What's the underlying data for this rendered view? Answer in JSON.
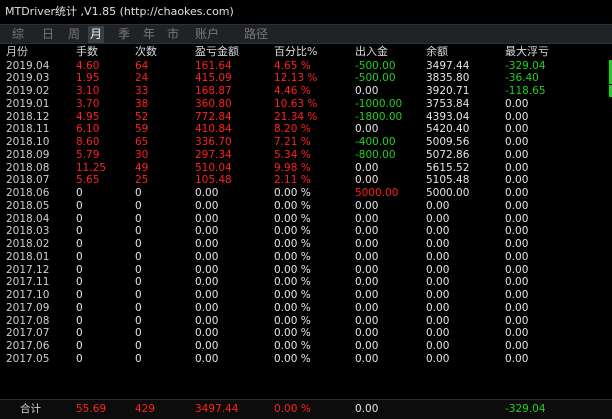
{
  "window": {
    "title": "MTDriver统计 ,V1.85 (http://chaokes.com)"
  },
  "tabs": [
    "综",
    "日",
    "周",
    "月",
    "季",
    "年",
    "市",
    "账户",
    "路径"
  ],
  "active_tab_index": 3,
  "columns": [
    "月份",
    "手数",
    "次数",
    "盈亏金额",
    "百分比%",
    "出入金",
    "余额",
    "最大浮亏"
  ],
  "rows": [
    [
      "2019.04",
      "4.60",
      "64",
      "161.64",
      "4.65 %",
      "-500.00",
      "3497.44",
      "-329.04"
    ],
    [
      "2019.03",
      "1.95",
      "24",
      "415.09",
      "12.13 %",
      "-500.00",
      "3835.80",
      "-36.40"
    ],
    [
      "2019.02",
      "3.10",
      "33",
      "168.87",
      "4.46 %",
      "0.00",
      "3920.71",
      "-118.65"
    ],
    [
      "2019.01",
      "3.70",
      "38",
      "360.80",
      "10.63 %",
      "-1000.00",
      "3753.84",
      "0.00"
    ],
    [
      "2018.12",
      "4.95",
      "52",
      "772.84",
      "21.34 %",
      "-1800.00",
      "4393.04",
      "0.00"
    ],
    [
      "2018.11",
      "6.10",
      "59",
      "410.84",
      "8.20 %",
      "0.00",
      "5420.40",
      "0.00"
    ],
    [
      "2018.10",
      "8.60",
      "65",
      "336.70",
      "7.21 %",
      "-400.00",
      "5009.56",
      "0.00"
    ],
    [
      "2018.09",
      "5.79",
      "30",
      "297.34",
      "5.34 %",
      "-800.00",
      "5072.86",
      "0.00"
    ],
    [
      "2018.08",
      "11.25",
      "49",
      "510.04",
      "9.98 %",
      "0.00",
      "5615.52",
      "0.00"
    ],
    [
      "2018.07",
      "5.65",
      "25",
      "105.48",
      "2.11 %",
      "0.00",
      "5105.48",
      "0.00"
    ],
    [
      "2018.06",
      "0",
      "0",
      "0.00",
      "0.00 %",
      "5000.00",
      "5000.00",
      "0.00"
    ],
    [
      "2018.05",
      "0",
      "0",
      "0.00",
      "0.00 %",
      "0.00",
      "0.00",
      "0.00"
    ],
    [
      "2018.04",
      "0",
      "0",
      "0.00",
      "0.00 %",
      "0.00",
      "0.00",
      "0.00"
    ],
    [
      "2018.03",
      "0",
      "0",
      "0.00",
      "0.00 %",
      "0.00",
      "0.00",
      "0.00"
    ],
    [
      "2018.02",
      "0",
      "0",
      "0.00",
      "0.00 %",
      "0.00",
      "0.00",
      "0.00"
    ],
    [
      "2018.01",
      "0",
      "0",
      "0.00",
      "0.00 %",
      "0.00",
      "0.00",
      "0.00"
    ],
    [
      "2017.12",
      "0",
      "0",
      "0.00",
      "0.00 %",
      "0.00",
      "0.00",
      "0.00"
    ],
    [
      "2017.11",
      "0",
      "0",
      "0.00",
      "0.00 %",
      "0.00",
      "0.00",
      "0.00"
    ],
    [
      "2017.10",
      "0",
      "0",
      "0.00",
      "0.00 %",
      "0.00",
      "0.00",
      "0.00"
    ],
    [
      "2017.09",
      "0",
      "0",
      "0.00",
      "0.00 %",
      "0.00",
      "0.00",
      "0.00"
    ],
    [
      "2017.08",
      "0",
      "0",
      "0.00",
      "0.00 %",
      "0.00",
      "0.00",
      "0.00"
    ],
    [
      "2017.07",
      "0",
      "0",
      "0.00",
      "0.00 %",
      "0.00",
      "0.00",
      "0.00"
    ],
    [
      "2017.06",
      "0",
      "0",
      "0.00",
      "0.00 %",
      "0.00",
      "0.00",
      "0.00"
    ],
    [
      "2017.05",
      "0",
      "0",
      "0.00",
      "0.00 %",
      "0.00",
      "0.00",
      "0.00"
    ]
  ],
  "totals": {
    "label": "合计",
    "lots": "55.69",
    "count": "429",
    "pnl": "3497.44",
    "pct": "0.00 %",
    "flow": "0.00",
    "balance": "",
    "maxdd": "-329.04"
  },
  "colors": {
    "negative": "#ff2020",
    "positive": "#1fd11f",
    "neutral": "#e6e6e6"
  }
}
